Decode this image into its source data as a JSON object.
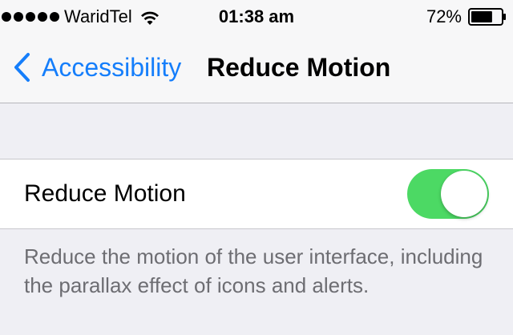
{
  "status_bar": {
    "carrier": "WaridTel",
    "time": "01:38 am",
    "battery": "72%",
    "signal_icon": "signal-dots-icon",
    "wifi_icon": "wifi-icon",
    "battery_icon": "battery-icon",
    "battery_level": 0.72
  },
  "nav": {
    "back_label": "Accessibility",
    "back_icon": "chevron-left-icon",
    "title": "Reduce Motion"
  },
  "settings": {
    "reduce_motion": {
      "label": "Reduce Motion",
      "enabled": true
    },
    "footer": "Reduce the motion of the user interface, including the parallax effect of icons and alerts."
  },
  "colors": {
    "accent": "#157efb",
    "toggle_on": "#4cd964",
    "background": "#efeff4",
    "footer_text": "#6d6d72"
  }
}
